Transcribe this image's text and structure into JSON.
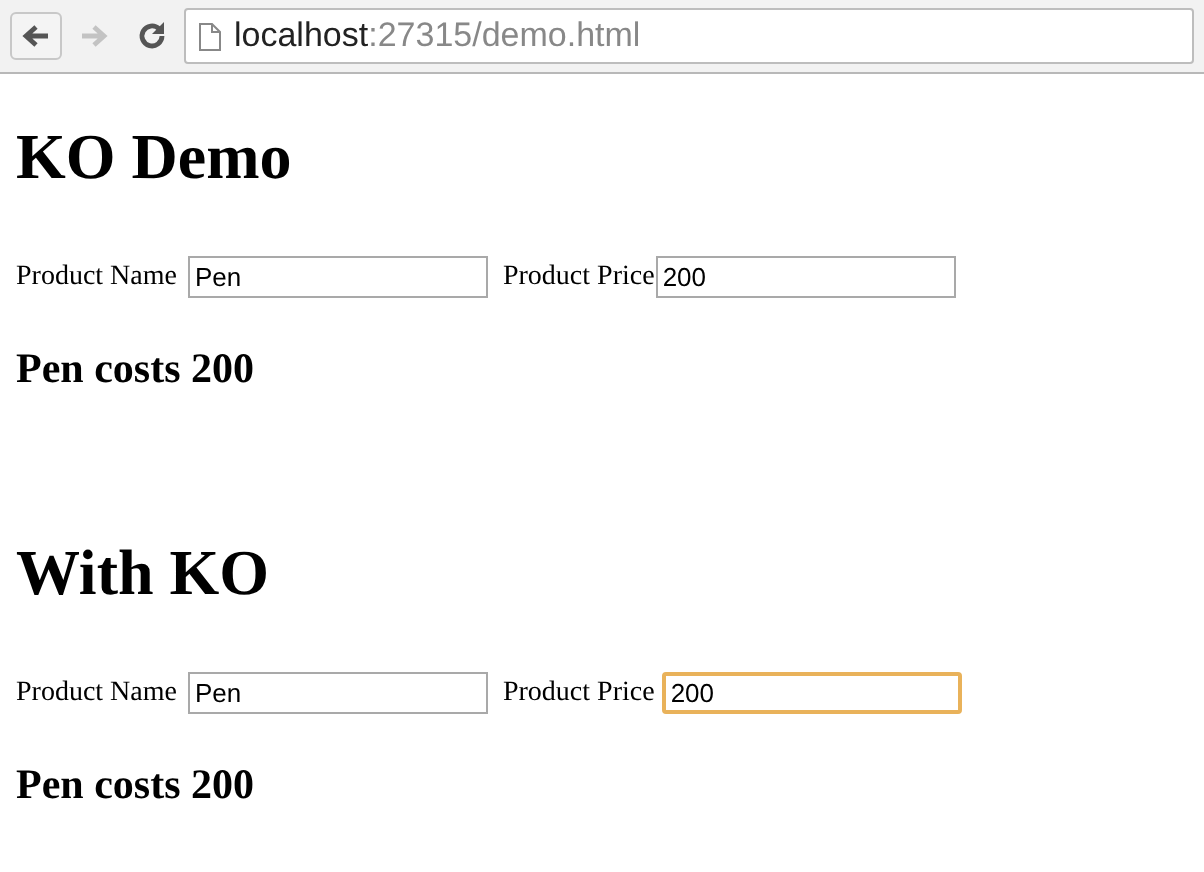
{
  "browser": {
    "back": {
      "disabled": false
    },
    "forward": {
      "disabled": true
    },
    "url_host": "localhost",
    "url_path": ":27315/demo.html"
  },
  "sections": [
    {
      "title": "KO Demo",
      "fields": [
        {
          "label": "Product Name",
          "value": "Pen",
          "focused": false
        },
        {
          "label": "Product Price",
          "value": "200",
          "focused": false
        }
      ],
      "result": "Pen costs 200"
    },
    {
      "title": "With KO",
      "fields": [
        {
          "label": "Product Name",
          "value": "Pen",
          "focused": false
        },
        {
          "label": "Product Price",
          "value": "200",
          "focused": true
        }
      ],
      "result": "Pen costs 200"
    }
  ]
}
